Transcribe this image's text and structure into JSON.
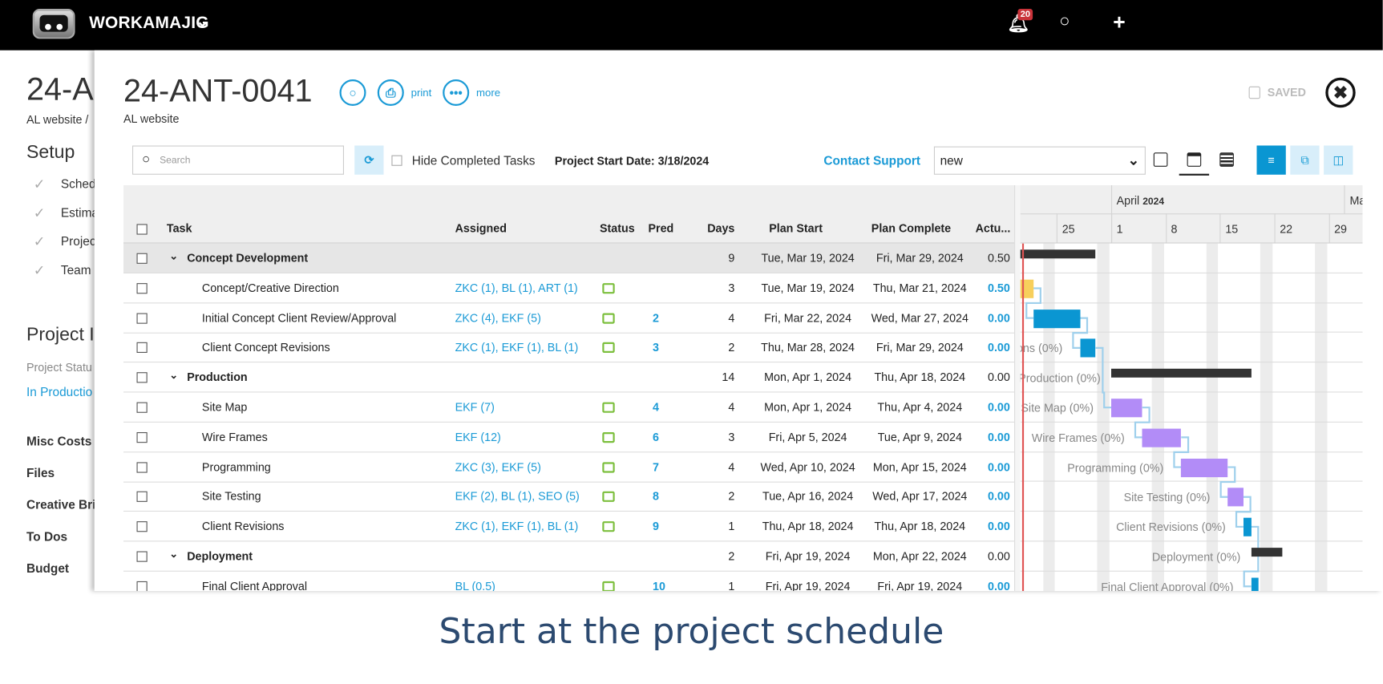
{
  "topbar": {
    "brand": "WORKAMAJIG",
    "notification_count": "20",
    "icons": [
      "bell-icon",
      "search-icon",
      "plus-icon"
    ]
  },
  "background_page": {
    "title": "24-A",
    "breadcrumb": "AL website /",
    "setup_heading": "Setup",
    "setup_items": [
      "Sched",
      "Estima",
      "Projec",
      "Team"
    ],
    "project_heading": "Project I",
    "project_status_label": "Project Statu",
    "project_status_value": "In Productio",
    "links": [
      "Misc Costs",
      "Files",
      "Creative Bri",
      "To Dos",
      "Budget"
    ]
  },
  "modal": {
    "title": "24-ANT-0041",
    "subtitle": "AL website",
    "print_label": "print",
    "more_label": "more",
    "saved_label": "SAVED",
    "search_placeholder": "Search",
    "hide_completed_label": "Hide Completed Tasks",
    "hide_completed_checked": false,
    "project_start": "Project Start Date: 3/18/2024",
    "contact_support": "Contact Support",
    "view_select": "new",
    "colors": {
      "accent": "#1a9ad6",
      "summary_bar": "#333333",
      "yellow": "#f7cf5c",
      "blue": "#0a96d2",
      "purple": "#b28cf7",
      "link_line": "#9fd0ec",
      "today": "#e05555"
    }
  },
  "table": {
    "headers": {
      "task": "Task",
      "assigned": "Assigned",
      "status": "Status",
      "pred": "Pred",
      "days": "Days",
      "plan_start": "Plan Start",
      "plan_complete": "Plan Complete",
      "actual": "Actu..."
    },
    "rows": [
      {
        "type": "group",
        "name": "Concept Development",
        "assigned": "",
        "pred": "",
        "days": "9",
        "start": "Tue, Mar 19, 2024",
        "complete": "Fri, Mar 29, 2024",
        "actual": "0.50",
        "selected": true
      },
      {
        "type": "task",
        "name": "Concept/Creative Direction",
        "assigned": "ZKC (1), BL (1), ART (1)",
        "pred": "",
        "days": "3",
        "start": "Tue, Mar 19, 2024",
        "complete": "Thu, Mar 21, 2024",
        "actual": "0.50"
      },
      {
        "type": "task",
        "name": "Initial Concept Client Review/Approval",
        "assigned": "ZKC (4), EKF (5)",
        "pred": "2",
        "days": "4",
        "start": "Fri, Mar 22, 2024",
        "complete": "Wed, Mar 27, 2024",
        "actual": "0.00"
      },
      {
        "type": "task",
        "name": "Client Concept Revisions",
        "assigned": "ZKC (1), EKF (1), BL (1)",
        "pred": "3",
        "days": "2",
        "start": "Thu, Mar 28, 2024",
        "complete": "Fri, Mar 29, 2024",
        "actual": "0.00"
      },
      {
        "type": "group",
        "name": "Production",
        "assigned": "",
        "pred": "",
        "days": "14",
        "start": "Mon, Apr 1, 2024",
        "complete": "Thu, Apr 18, 2024",
        "actual": "0.00"
      },
      {
        "type": "task",
        "name": "Site Map",
        "assigned": "EKF (7)",
        "pred": "4",
        "days": "4",
        "start": "Mon, Apr 1, 2024",
        "complete": "Thu, Apr 4, 2024",
        "actual": "0.00"
      },
      {
        "type": "task",
        "name": "Wire Frames",
        "assigned": "EKF (12)",
        "pred": "6",
        "days": "3",
        "start": "Fri, Apr 5, 2024",
        "complete": "Tue, Apr 9, 2024",
        "actual": "0.00"
      },
      {
        "type": "task",
        "name": "Programming",
        "assigned": "ZKC (3), EKF (5)",
        "pred": "7",
        "days": "4",
        "start": "Wed, Apr 10, 2024",
        "complete": "Mon, Apr 15, 2024",
        "actual": "0.00"
      },
      {
        "type": "task",
        "name": "Site Testing",
        "assigned": "EKF (2), BL (1), SEO (5)",
        "pred": "8",
        "days": "2",
        "start": "Tue, Apr 16, 2024",
        "complete": "Wed, Apr 17, 2024",
        "actual": "0.00"
      },
      {
        "type": "task",
        "name": "Client Revisions",
        "assigned": "ZKC (1), EKF (1), BL (1)",
        "pred": "9",
        "days": "1",
        "start": "Thu, Apr 18, 2024",
        "complete": "Thu, Apr 18, 2024",
        "actual": "0.00"
      },
      {
        "type": "group",
        "name": "Deployment",
        "assigned": "",
        "pred": "",
        "days": "2",
        "start": "Fri, Apr 19, 2024",
        "complete": "Mon, Apr 22, 2024",
        "actual": "0.00"
      },
      {
        "type": "task",
        "name": "Final Client Approval",
        "assigned": "BL (0.5)",
        "pred": "10",
        "days": "1",
        "start": "Fri, Apr 19, 2024",
        "complete": "Fri, Apr 19, 2024",
        "actual": "0.00"
      }
    ]
  },
  "gantt": {
    "month": "April",
    "year": "2024",
    "next_month": "Ma",
    "week_labels": [
      "25",
      "1",
      "8",
      "15",
      "22",
      "29"
    ],
    "bars": [
      {
        "start": "2024-03-19",
        "end": "2024-03-29",
        "kind": "summary",
        "color": "#333333",
        "progress": "0%"
      },
      {
        "start": "2024-03-19",
        "end": "2024-03-21",
        "kind": "task",
        "color": "#f7cf5c",
        "progress": "0%"
      },
      {
        "start": "2024-03-22",
        "end": "2024-03-27",
        "kind": "task",
        "color": "#0a96d2",
        "progress": "0%"
      },
      {
        "start": "2024-03-28",
        "end": "2024-03-29",
        "kind": "task",
        "color": "#0a96d2",
        "progress": "0%"
      },
      {
        "start": "2024-04-01",
        "end": "2024-04-18",
        "kind": "summary",
        "color": "#333333",
        "progress": "0%"
      },
      {
        "start": "2024-04-01",
        "end": "2024-04-04",
        "kind": "task",
        "color": "#b28cf7",
        "progress": "0%"
      },
      {
        "start": "2024-04-05",
        "end": "2024-04-09",
        "kind": "task",
        "color": "#b28cf7",
        "progress": "0%"
      },
      {
        "start": "2024-04-10",
        "end": "2024-04-15",
        "kind": "task",
        "color": "#b28cf7",
        "progress": "0%"
      },
      {
        "start": "2024-04-16",
        "end": "2024-04-17",
        "kind": "task",
        "color": "#b28cf7",
        "progress": "0%"
      },
      {
        "start": "2024-04-18",
        "end": "2024-04-18",
        "kind": "task",
        "color": "#0a96d2",
        "progress": "0%"
      },
      {
        "start": "2024-04-19",
        "end": "2024-04-22",
        "kind": "summary",
        "color": "#333333",
        "progress": "0%"
      },
      {
        "start": "2024-04-19",
        "end": "2024-04-19",
        "kind": "task",
        "color": "#0a96d2",
        "progress": "0%"
      }
    ]
  },
  "caption": "Start at the project schedule"
}
